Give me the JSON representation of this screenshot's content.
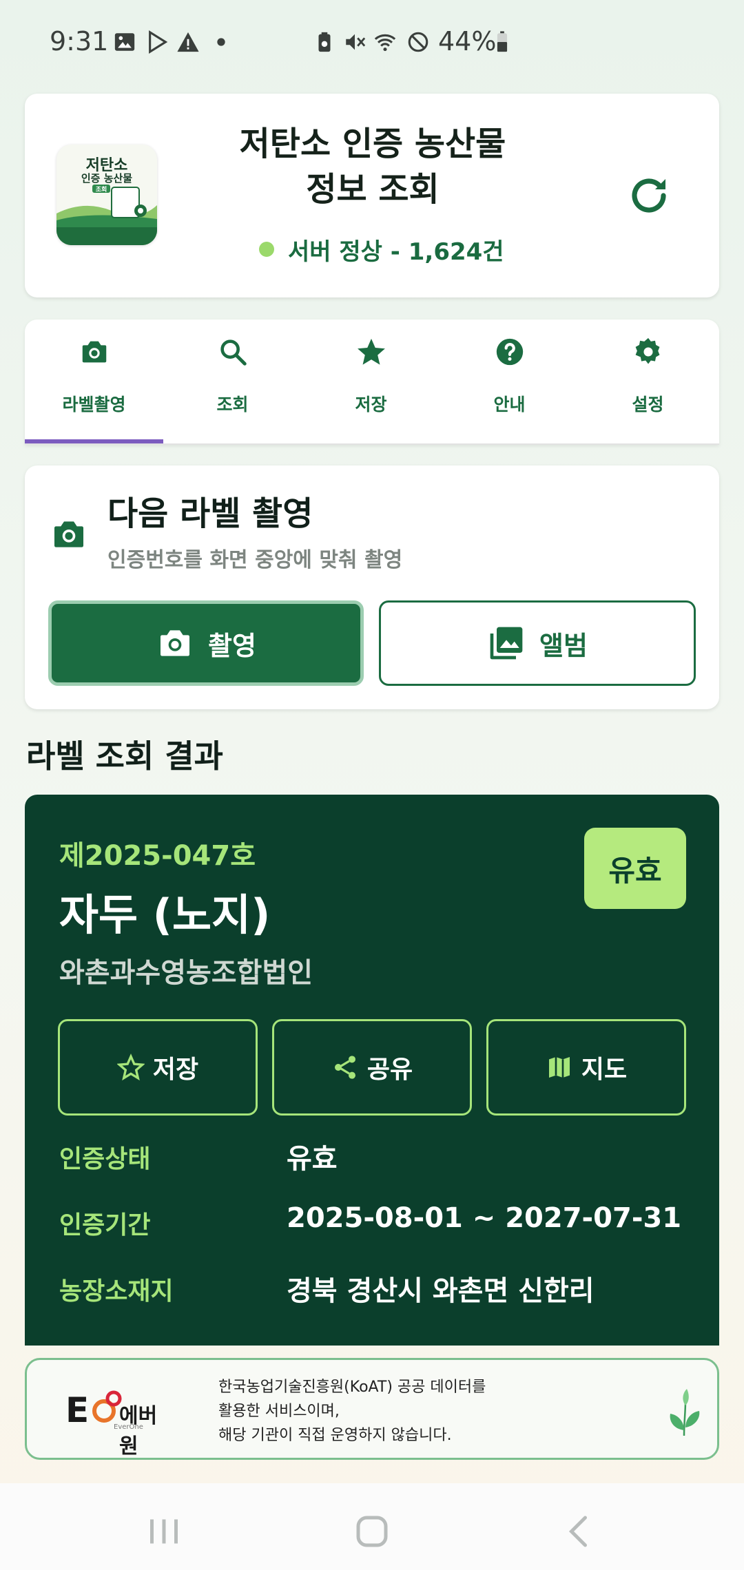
{
  "status_bar": {
    "time": "9:31",
    "battery": "44%"
  },
  "header": {
    "logo_title": "저탄소",
    "logo_sub": "인증 농산물",
    "logo_badge": "조회",
    "title_line1": "저탄소 인증 농산물",
    "title_line2": "정보 조회",
    "server_status": "서버 정상 - 1,624건",
    "status_color": "#9bd96b",
    "refresh_icon": "refresh-icon"
  },
  "tabs": [
    {
      "label": "라벨촬영",
      "icon": "camera-icon",
      "active": true
    },
    {
      "label": "조회",
      "icon": "search-icon",
      "active": false
    },
    {
      "label": "저장",
      "icon": "star-icon",
      "active": false
    },
    {
      "label": "안내",
      "icon": "help-icon",
      "active": false
    },
    {
      "label": "설정",
      "icon": "gear-icon",
      "active": false
    }
  ],
  "capture": {
    "title": "다음 라벨 촬영",
    "subtitle": "인증번호를 화면 중앙에 맞춰 촬영",
    "shoot_label": "촬영",
    "album_label": "앨범"
  },
  "results": {
    "section_title": "라벨 조회 결과",
    "cert_no": "제2025-047호",
    "product": "자두 (노지)",
    "organization": "와촌과수영농조합법인",
    "badge": "유효",
    "actions": {
      "save": "저장",
      "share": "공유",
      "map": "지도"
    },
    "info": [
      {
        "label": "인증상태",
        "value": "유효"
      },
      {
        "label": "인증기간",
        "value": "2025-08-01 ~ 2027-07-31"
      },
      {
        "label": "농장소재지",
        "value": "경북 경산시 와촌면 신한리"
      }
    ]
  },
  "footer": {
    "logo_text": "에버원",
    "logo_sub": "EverOne",
    "line1": "한국농업기술진흥원(KoAT) 공공 데이터를",
    "line2": "활용한 서비스이며,",
    "line3": "해당 기관이 직접 운영하지 않습니다."
  },
  "colors": {
    "primary": "#1b6c41",
    "dark_card": "#0b3f2c",
    "accent": "#a6e57a",
    "tab_indicator": "#7c5cbf"
  }
}
